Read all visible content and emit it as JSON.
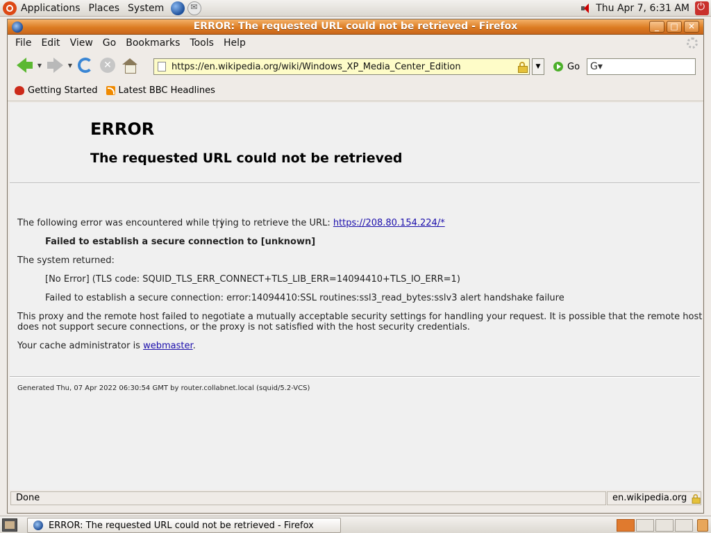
{
  "top_panel": {
    "menus": [
      "Applications",
      "Places",
      "System"
    ],
    "clock": "Thu Apr  7,  6:31 AM"
  },
  "window": {
    "title": "ERROR: The requested URL could not be retrieved - Firefox"
  },
  "menubar": {
    "items": [
      "File",
      "Edit",
      "View",
      "Go",
      "Bookmarks",
      "Tools",
      "Help"
    ]
  },
  "navbar": {
    "url": "https://en.wikipedia.org/wiki/Windows_XP_Media_Center_Edition",
    "go_label": "Go",
    "search_value": ""
  },
  "bookmarks": {
    "items": [
      "Getting Started",
      "Latest BBC Headlines"
    ]
  },
  "page": {
    "title": "ERROR",
    "subtitle": "The requested URL could not be retrieved",
    "intro_text": "The following error was encountered while trying to retrieve the URL: ",
    "intro_link": "https://208.80.154.224/*",
    "error_detail": "Failed to establish a secure connection to [unknown]",
    "system_returned": "The system returned:",
    "tls_code": "[No Error] (TLS code: SQUID_TLS_ERR_CONNECT+TLS_LIB_ERR=14094410+TLS_IO_ERR=1)",
    "ssl_error": "Failed to establish a secure connection: error:14094410:SSL routines:ssl3_read_bytes:sslv3 alert handshake failure",
    "proxy_line1": "This proxy and the remote host failed to negotiate a mutually acceptable security settings for handling your request. It is possible that the remote host",
    "proxy_line2": "does not support secure connections, or the proxy is not satisfied with the host security credentials.",
    "admin_prefix": "Your cache administrator is ",
    "admin_link": "webmaster",
    "admin_suffix": ".",
    "footer": "Generated Thu, 07 Apr 2022 06:30:54 GMT by router.collabnet.local (squid/5.2-VCS)"
  },
  "statusbar": {
    "status": "Done",
    "domain": "en.wikipedia.org"
  },
  "taskbar": {
    "task_label": "ERROR: The requested URL could not be retrieved - Firefox"
  }
}
